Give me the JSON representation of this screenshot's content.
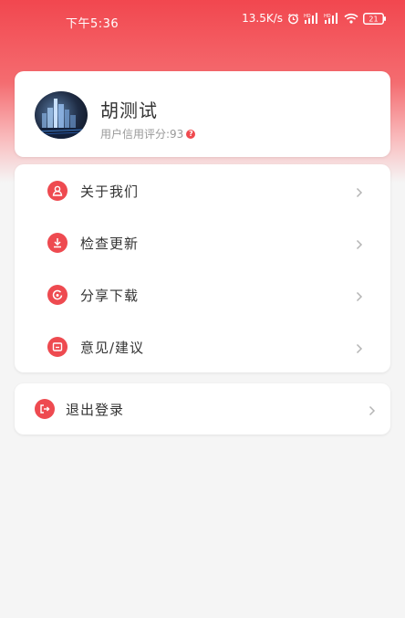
{
  "status_bar": {
    "time": "下午5:36",
    "network_speed": "13.5K/s",
    "icons": [
      "alarm-icon",
      "signal-hd-icon",
      "signal-hd-icon",
      "wifi-icon",
      "battery-icon"
    ],
    "battery_level": "21"
  },
  "profile": {
    "name": "胡测试",
    "credit_label": "用户信用评分:93",
    "help_mark": "?",
    "avatar_icon": "city-avatar"
  },
  "menu": {
    "items": [
      {
        "label": "关于我们",
        "icon": "user-icon"
      },
      {
        "label": "检查更新",
        "icon": "download-icon"
      },
      {
        "label": "分享下载",
        "icon": "share-icon"
      },
      {
        "label": "意见/建议",
        "icon": "feedback-icon"
      }
    ]
  },
  "logout": {
    "label": "退出登录",
    "icon": "logout-icon"
  },
  "colors": {
    "accent": "#ee4a50",
    "header_top": "#f2474f",
    "background": "#f5f5f5"
  }
}
